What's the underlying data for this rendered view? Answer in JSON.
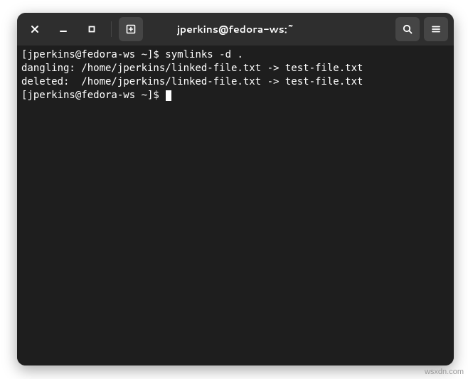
{
  "header": {
    "title": "jperkins@fedora-ws:~"
  },
  "terminal": {
    "lines": [
      {
        "prompt": "[jperkins@fedora-ws ~]$ ",
        "command": "symlinks -d ."
      },
      {
        "text": "dangling: /home/jperkins/linked-file.txt -> test-file.txt"
      },
      {
        "text": "deleted:  /home/jperkins/linked-file.txt -> test-file.txt"
      },
      {
        "prompt": "[jperkins@fedora-ws ~]$ ",
        "command": "",
        "cursor": true
      }
    ]
  },
  "watermark": "wsxdn.com"
}
